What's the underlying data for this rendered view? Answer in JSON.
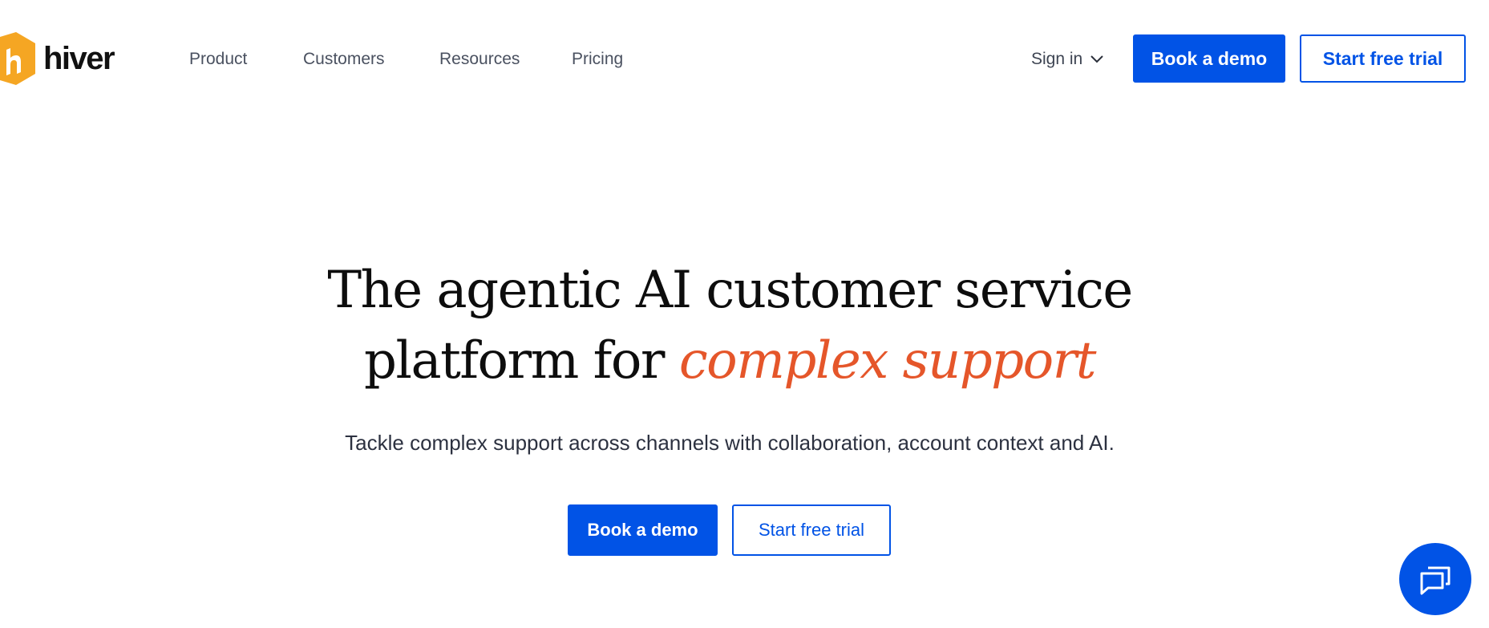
{
  "header": {
    "logo_text": "hiver",
    "brand_color": "#F5A623",
    "nav": [
      {
        "label": "Product"
      },
      {
        "label": "Customers"
      },
      {
        "label": "Resources"
      },
      {
        "label": "Pricing"
      }
    ],
    "signin_label": "Sign in",
    "book_demo_label": "Book a demo",
    "start_trial_label": "Start free trial"
  },
  "hero": {
    "title_line1": "The agentic AI customer service",
    "title_line2_prefix": "platform for ",
    "title_line2_accent": "complex support",
    "accent_color": "#E5562A",
    "subtitle": "Tackle complex support across channels with collaboration, account context and AI.",
    "book_demo_label": "Book a demo",
    "start_trial_label": "Start free trial"
  },
  "theme": {
    "primary_color": "#0153E6"
  },
  "chat_widget": {
    "icon": "chat-bubbles-icon"
  }
}
